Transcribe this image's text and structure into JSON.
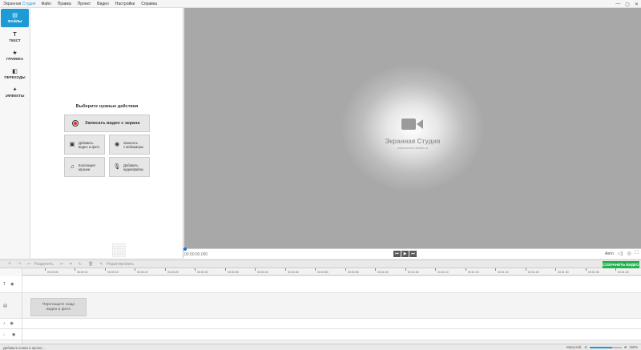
{
  "menubar": {
    "app_name_prefix": "Экранная ",
    "app_name_accent": "Студия",
    "items": [
      "Файл",
      "Правка",
      "Проект",
      "Видео",
      "Настройки",
      "Справка"
    ],
    "window_controls": {
      "minimize": "—",
      "maximize": "▢",
      "close": "✕"
    }
  },
  "rail": {
    "tabs": [
      {
        "label": "ФАЙЛЫ",
        "icon": "film-icon",
        "glyph": "▤",
        "active": true
      },
      {
        "label": "ТЕКСТ",
        "icon": "text-icon",
        "glyph": "T",
        "active": false
      },
      {
        "label": "ГРАФИКА",
        "icon": "star-icon",
        "glyph": "★",
        "active": false
      },
      {
        "label": "ПЕРЕХОДЫ",
        "icon": "transitions-icon",
        "glyph": "◧",
        "active": false
      },
      {
        "label": "ЭФФЕКТЫ",
        "icon": "wand-icon",
        "glyph": "✦",
        "active": false
      }
    ]
  },
  "panel": {
    "heading": "Выберите нужные действия",
    "record_button": "Записать видео с экрана",
    "buttons": [
      {
        "line1": "Добавить",
        "line2": "видео и фото",
        "icon": "film-strip-icon",
        "glyph": "▣"
      },
      {
        "line1": "Записать",
        "line2": "с вебкамеры",
        "icon": "webcam-icon",
        "glyph": "◉"
      },
      {
        "line1": "Коллекция",
        "line2": "музыки",
        "icon": "music-collection-icon",
        "glyph": "♫"
      },
      {
        "line1": "Добавить",
        "line2": "аудиофайлы",
        "icon": "microphone-icon",
        "glyph": "🎙"
      }
    ]
  },
  "preview": {
    "brand": "Экранная Студия",
    "url": "www.screen-studio.ru"
  },
  "player": {
    "time": "00:00:00.000",
    "buttons": {
      "prev": "⏮",
      "play": "▶",
      "next": "⏭"
    },
    "aspect": "Авто"
  },
  "toolbar": {
    "undo": "↶",
    "redo": "↷",
    "split": "Разделить",
    "edit": "Редактировать",
    "save_video": "СОХРАНИТЬ ВИДЕО"
  },
  "ruler": {
    "ticks": [
      "00:00:05",
      "00:00:10",
      "00:00:15",
      "00:00:20",
      "00:00:25",
      "00:00:30",
      "00:00:35",
      "00:00:40",
      "00:00:45",
      "00:00:50",
      "00:00:55",
      "00:01:00",
      "00:01:05",
      "00:01:10",
      "00:01:15",
      "00:01:20",
      "00:01:25",
      "00:01:30",
      "00:01:35",
      "00:01:40"
    ]
  },
  "timeline": {
    "dropzone_line1": "Перетащите сюда",
    "dropzone_line2": "видео и фото"
  },
  "status": {
    "message": "Добавьте клипы в проект...",
    "zoom_label": "Масштаб:",
    "zoom_value": "150%",
    "zoom_fraction": 0.7
  }
}
